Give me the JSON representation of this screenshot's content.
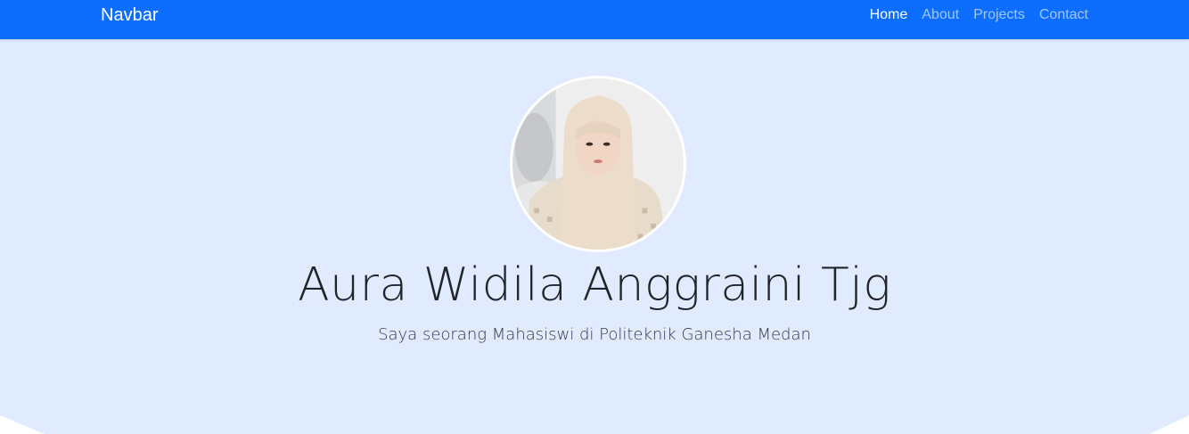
{
  "navbar": {
    "brand": "Navbar",
    "links": [
      {
        "label": "Home",
        "active": true
      },
      {
        "label": "About",
        "active": false
      },
      {
        "label": "Projects",
        "active": false
      },
      {
        "label": "Contact",
        "active": false
      }
    ],
    "bg_color": "#0d6efd"
  },
  "hero": {
    "name": "Aura Widila Anggraini Tjg",
    "subtitle": "Saya seorang Mahasiswi di Politeknik Ganesha Medan",
    "bg_color": "#e0ebff",
    "avatar_icon": "profile-photo"
  }
}
